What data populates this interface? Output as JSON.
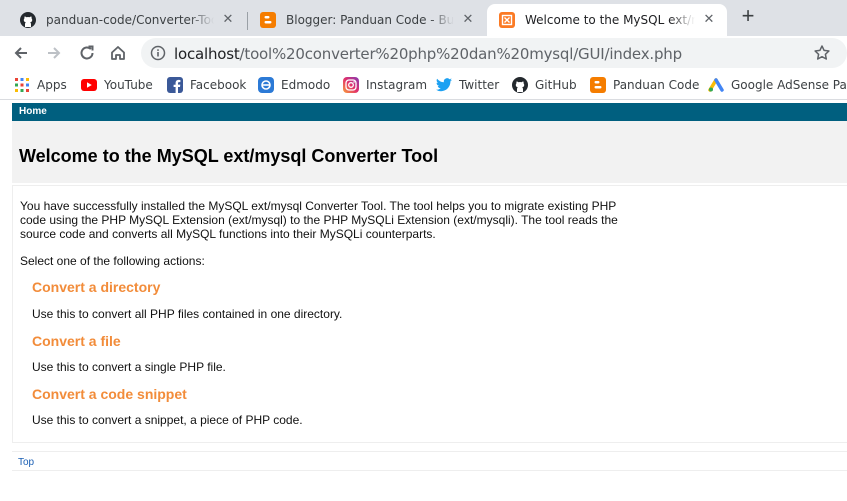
{
  "browser": {
    "tabs": [
      {
        "title": "panduan-code/Converter-Tool-PHP",
        "icon": "github-icon",
        "close": "✕"
      },
      {
        "title": "Blogger: Panduan Code - Buat entri",
        "icon": "blogger-icon",
        "close": "✕"
      },
      {
        "title": "Welcome to the MySQL ext/mysql Converter Tool",
        "icon": "xampp-icon",
        "close": "✕",
        "active": true
      }
    ],
    "new_tab": "+",
    "url_host": "localhost",
    "url_path": "/tool%20converter%20php%20dan%20mysql/GUI/index.php",
    "bookmarks": [
      {
        "label": "Apps",
        "icon": "apps-grid-icon"
      },
      {
        "label": "YouTube",
        "icon": "youtube-icon"
      },
      {
        "label": "Facebook",
        "icon": "facebook-icon"
      },
      {
        "label": "Edmodo",
        "icon": "edmodo-icon"
      },
      {
        "label": "Instagram",
        "icon": "instagram-icon"
      },
      {
        "label": "Twitter",
        "icon": "twitter-icon"
      },
      {
        "label": "GitHub",
        "icon": "github-icon"
      },
      {
        "label": "Panduan Code",
        "icon": "blogger-icon"
      },
      {
        "label": "Google AdSense Pa...",
        "icon": "adsense-icon"
      }
    ]
  },
  "page": {
    "nav_home": "Home",
    "title": "Welcome to the MySQL ext/mysql Converter Tool",
    "intro": "You have successfully installed the MySQL ext/mysql Converter Tool. The tool helps you to migrate existing PHP code using the PHP MySQL Extension (ext/mysql) to the PHP MySQLi Extension (ext/mysqli). The tool reads the source code and converts all MySQL functions into their MySQLi counterparts.",
    "prompt": "Select one of the following actions:",
    "actions": [
      {
        "label": "Convert a directory",
        "desc": "Use this to convert all PHP files contained in one directory."
      },
      {
        "label": "Convert a file",
        "desc": "Use this to convert a single PHP file."
      },
      {
        "label": "Convert a code snippet",
        "desc": "Use this to convert a snippet, a piece of PHP code."
      }
    ],
    "footer_top": "Top"
  },
  "colors": {
    "nav_bar": "#005f7f",
    "action_link": "#f28c3a",
    "footer_link": "#1a5fb4"
  }
}
